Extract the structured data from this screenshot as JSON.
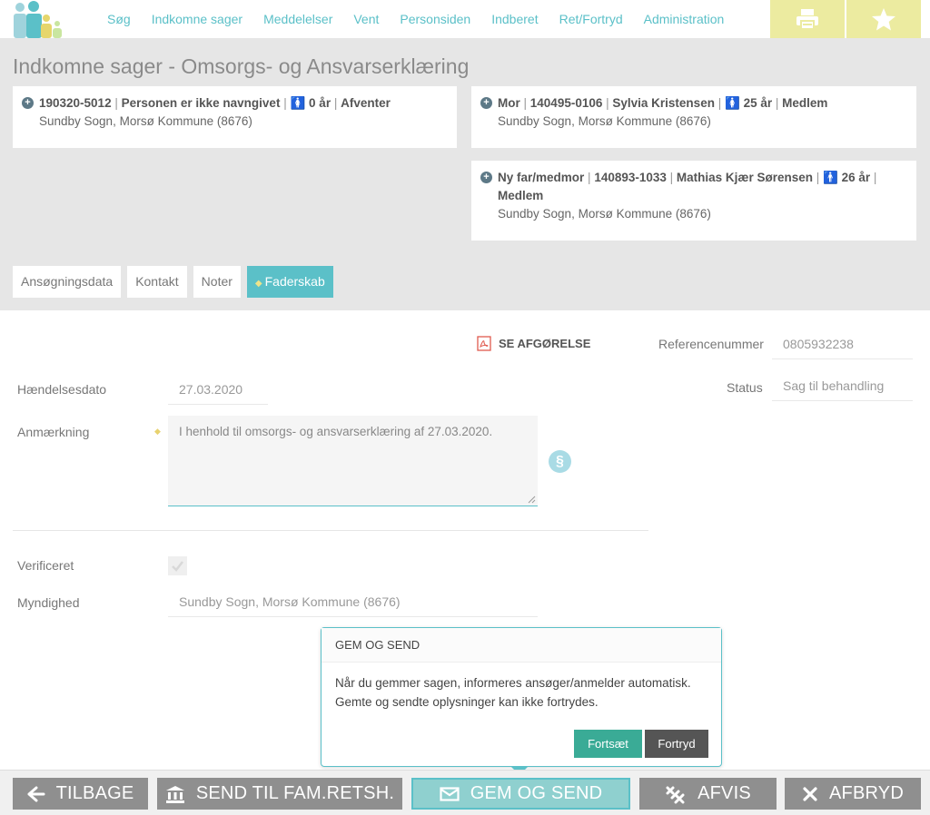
{
  "nav": {
    "items": [
      "Søg",
      "Indkomne sager",
      "Meddelelser",
      "Vent",
      "Personsiden",
      "Indberet",
      "Ret/Fortryd",
      "Administration"
    ],
    "print_icon": "printer-icon",
    "star_icon": "star-icon"
  },
  "page": {
    "title": "Indkomne sager - Omsorgs- og Ansvarserklæring"
  },
  "cards": {
    "child": {
      "id": "190320-5012",
      "name": "Personen er ikke navngivet",
      "age": "0 år",
      "status": "Afventer",
      "place": "Sundby Sogn, Morsø Kommune (8676)"
    },
    "mother": {
      "role": "Mor",
      "id": "140495-0106",
      "name": "Sylvia Kristensen",
      "age": "25 år",
      "status": "Medlem",
      "place": "Sundby Sogn, Morsø Kommune (8676)"
    },
    "father": {
      "role": "Ny far/medmor",
      "id": "140893-1033",
      "name": "Mathias Kjær Sørensen",
      "age": "26 år",
      "status": "Medlem",
      "place": "Sundby Sogn, Morsø Kommune (8676)"
    }
  },
  "tabs": [
    "Ansøgningsdata",
    "Kontakt",
    "Noter",
    "Faderskab"
  ],
  "form": {
    "see_decision": "SE AFGØRELSE",
    "reference_label": "Referencenummer",
    "reference_value": "0805932238",
    "event_date_label": "Hændelsesdato",
    "event_date_value": "27.03.2020",
    "status_label": "Status",
    "status_value": "Sag til behandling",
    "remark_label": "Anmærkning",
    "remark_value": "I henhold til omsorgs- og ansvarserklæring af 27.03.2020.",
    "paragraph_symbol": "§",
    "verified_label": "Verificeret",
    "verified_checked": true,
    "authority_label": "Myndighed",
    "authority_value": "Sundby Sogn, Morsø Kommune (8676)"
  },
  "popover": {
    "title": "GEM OG SEND",
    "line1": "Når du gemmer sagen, informeres ansøger/anmelder automatisk.",
    "line2": "Gemte og sendte oplysninger kan ikke fortrydes.",
    "continue": "Fortsæt",
    "cancel": "Fortryd"
  },
  "actions": {
    "back": "TILBAGE",
    "send_famret": "SEND TIL FAM.RETSH.",
    "save_send": "GEM OG SEND",
    "reject": "AFVIS",
    "abort": "AFBRYD"
  },
  "colors": {
    "accent": "#5bc0c8",
    "header_bg": "#e6e6e6",
    "topbtn_bg": "#eceba0",
    "action_bg": "#8f8f8f",
    "confirm": "#3aab96"
  }
}
